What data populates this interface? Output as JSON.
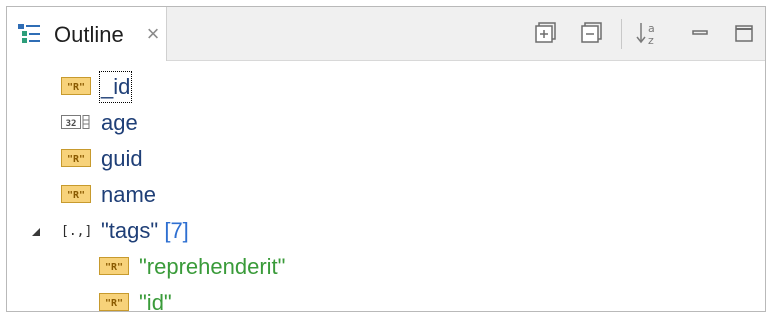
{
  "tab": {
    "title": "Outline",
    "close_glyph": "×",
    "icon": "outline-view-icon"
  },
  "toolbar": {
    "buttons": [
      {
        "name": "expand-all",
        "icon": "expand-all-icon"
      },
      {
        "name": "collapse-all",
        "icon": "collapse-all-icon"
      },
      {
        "name": "sort",
        "icon": "sort-az-icon"
      },
      {
        "name": "minimize",
        "icon": "minimize-icon"
      },
      {
        "name": "maximize",
        "icon": "maximize-icon"
      }
    ]
  },
  "tree": {
    "items": [
      {
        "label": "_id",
        "type": "string",
        "focused": true
      },
      {
        "label": "age",
        "type": "number"
      },
      {
        "label": "guid",
        "type": "string"
      },
      {
        "label": "name",
        "type": "string"
      },
      {
        "label": "\"tags\"",
        "count": "[7]",
        "type": "array",
        "expanded": true
      },
      {
        "label": "\"reprehenderit\"",
        "type": "string"
      },
      {
        "label": "\"id\"",
        "type": "string"
      }
    ]
  },
  "colors": {
    "key_text": "#1f3f77",
    "value_text": "#3a9b3a",
    "count_text": "#2e6fd1",
    "string_icon_fill": "#f7d27a",
    "string_icon_border": "#c79a2d"
  }
}
